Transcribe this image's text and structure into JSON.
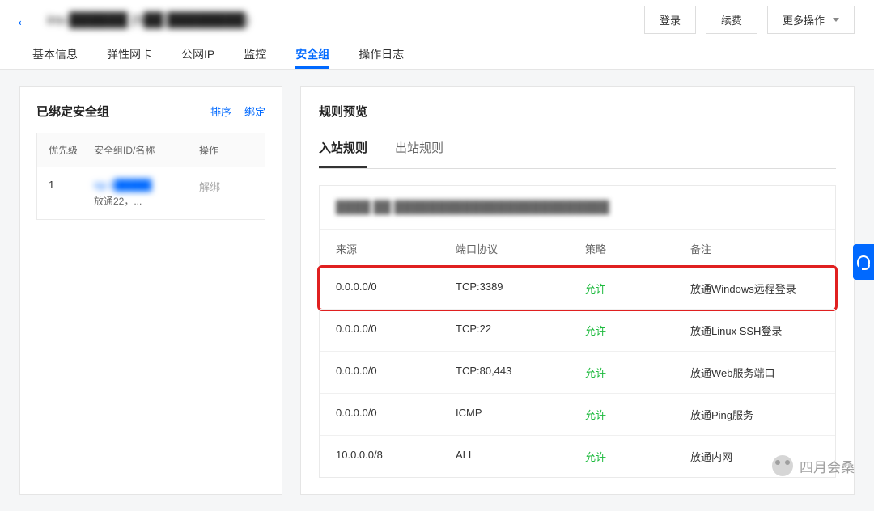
{
  "header": {
    "instance_id": "ins-██████",
    "instance_desc": "(h██ ████████)",
    "login_btn": "登录",
    "renew_btn": "续费",
    "more_btn": "更多操作"
  },
  "nav": {
    "tabs": [
      "基本信息",
      "弹性网卡",
      "公网IP",
      "监控",
      "安全组",
      "操作日志"
    ],
    "active_index": 4
  },
  "bound_sg": {
    "title": "已绑定安全组",
    "sort_link": "排序",
    "bind_link": "绑定",
    "head_priority": "优先级",
    "head_idname": "安全组ID/名称",
    "head_action": "操作",
    "rows": [
      {
        "priority": "1",
        "id": "sg-1█████",
        "name": "放通22，...",
        "action": "解绑"
      }
    ]
  },
  "preview": {
    "title": "规则预览",
    "tab_in": "入站规则",
    "tab_out": "出站规则",
    "group_label": "████ ██ █████████████████████████",
    "head_source": "来源",
    "head_port": "端口协议",
    "head_policy": "策略",
    "head_remark": "备注",
    "rules": [
      {
        "source": "0.0.0.0/0",
        "port": "TCP:3389",
        "policy": "允许",
        "remark": "放通Windows远程登录",
        "highlight": true
      },
      {
        "source": "0.0.0.0/0",
        "port": "TCP:22",
        "policy": "允许",
        "remark": "放通Linux SSH登录"
      },
      {
        "source": "0.0.0.0/0",
        "port": "TCP:80,443",
        "policy": "允许",
        "remark": "放通Web服务端口"
      },
      {
        "source": "0.0.0.0/0",
        "port": "ICMP",
        "policy": "允许",
        "remark": "放通Ping服务"
      },
      {
        "source": "10.0.0.0/8",
        "port": "ALL",
        "policy": "允许",
        "remark": "放通内网"
      }
    ]
  },
  "watermark": "四月会桑"
}
